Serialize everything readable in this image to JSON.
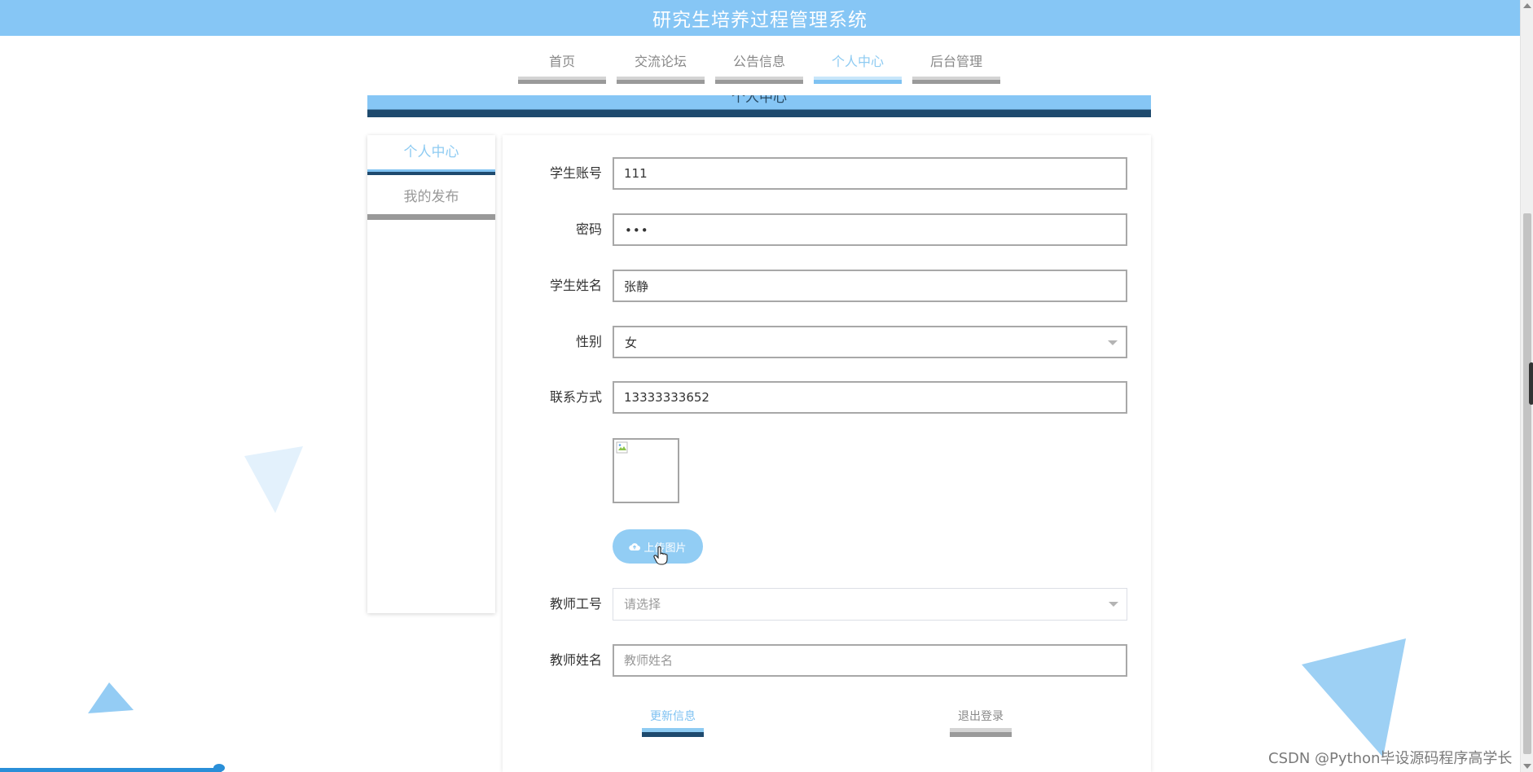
{
  "header": {
    "title": "研究生培养过程管理系统"
  },
  "nav": {
    "items": [
      {
        "label": "首页"
      },
      {
        "label": "交流论坛"
      },
      {
        "label": "公告信息"
      },
      {
        "label": "个人中心"
      },
      {
        "label": "后台管理"
      }
    ],
    "active": "个人中心"
  },
  "banner": {
    "text": "个人中心"
  },
  "sidebar": {
    "items": [
      {
        "label": "个人中心"
      },
      {
        "label": "我的发布"
      }
    ]
  },
  "form": {
    "account": {
      "label": "学生账号",
      "value": "111"
    },
    "password": {
      "label": "密码",
      "value": "•••"
    },
    "name": {
      "label": "学生姓名",
      "value": "张静"
    },
    "gender": {
      "label": "性别",
      "value": "女"
    },
    "phone": {
      "label": "联系方式",
      "value": "13333333652"
    },
    "upload_label": "上传图片",
    "teacher_id": {
      "label": "教师工号",
      "placeholder": "请选择"
    },
    "teacher_name": {
      "label": "教师姓名",
      "placeholder": "教师姓名"
    }
  },
  "actions": {
    "update": "更新信息",
    "logout": "退出登录"
  },
  "watermark": "CSDN @Python毕设源码程序高学长",
  "colors": {
    "header": "#86c6f5",
    "accent": "#7fc2f2",
    "dark_accent": "#1e4a6e"
  },
  "video_progress": 0.145
}
